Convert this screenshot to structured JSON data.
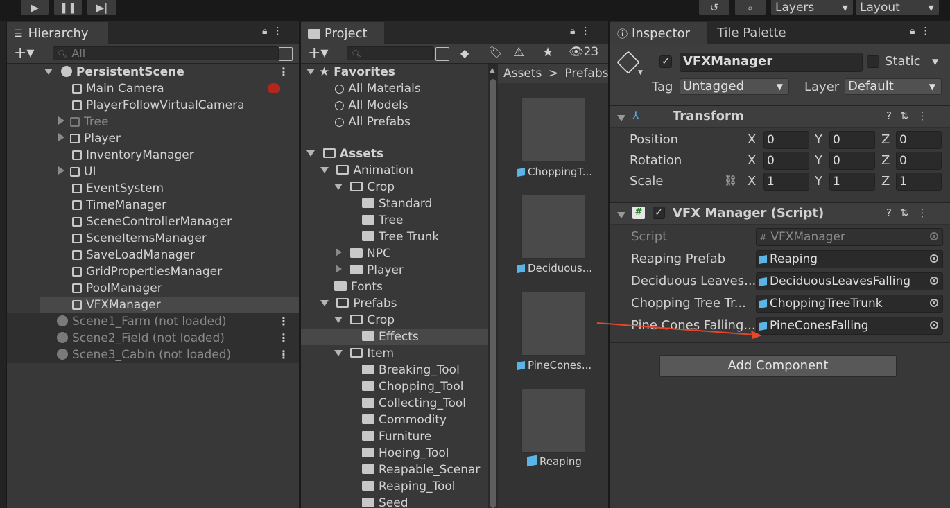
{
  "toolbar": {
    "layers": "Layers",
    "layout": "Layout"
  },
  "hierarchy": {
    "tab": "Hierarchy",
    "search_placeholder": "All",
    "scene": "PersistentScene",
    "items": [
      "Main Camera",
      "PlayerFollowVirtualCamera",
      "Tree",
      "Player",
      "InventoryManager",
      "UI",
      "EventSystem",
      "TimeManager",
      "SceneControllerManager",
      "SceneItemsManager",
      "SaveLoadManager",
      "GridPropertiesManager",
      "PoolManager",
      "VFXManager"
    ],
    "unloaded": [
      "Scene1_Farm (not loaded)",
      "Scene2_Field (not loaded)",
      "Scene3_Cabin (not loaded)"
    ]
  },
  "project": {
    "tab": "Project",
    "count": "23",
    "favorites": "Favorites",
    "fav_items": [
      "All Materials",
      "All Models",
      "All Prefabs"
    ],
    "assets": "Assets",
    "tree": [
      "Animation",
      "Crop",
      "Standard",
      "Tree",
      "Tree Trunk",
      "NPC",
      "Player",
      "Fonts",
      "Prefabs",
      "Crop",
      "Effects",
      "Item",
      "Breaking_Tool",
      "Chopping_Tool",
      "Collecting_Tool",
      "Commodity",
      "Furniture",
      "Hoeing_Tool",
      "Reapable_Scenar",
      "Reaping_Tool",
      "Seed"
    ],
    "breadcrumb": [
      "Assets",
      ">",
      "Prefabs"
    ],
    "thumbs": [
      "ChoppingT...",
      "Deciduous...",
      "PineCones...",
      "Reaping"
    ]
  },
  "inspector": {
    "tab": "Inspector",
    "tab2": "Tile Palette",
    "object_name": "VFXManager",
    "static": "Static",
    "tag_label": "Tag",
    "tag": "Untagged",
    "layer_label": "Layer",
    "layer": "Default",
    "transform": {
      "title": "Transform",
      "rows": [
        {
          "label": "Position",
          "x": "0",
          "y": "0",
          "z": "0"
        },
        {
          "label": "Rotation",
          "x": "0",
          "y": "0",
          "z": "0"
        },
        {
          "label": "Scale",
          "x": "1",
          "y": "1",
          "z": "1"
        }
      ],
      "axes": [
        "X",
        "Y",
        "Z"
      ]
    },
    "script": {
      "title": "VFX Manager (Script)",
      "fields": [
        {
          "label": "Script",
          "value": "VFXManager"
        },
        {
          "label": "Reaping Prefab",
          "value": "Reaping"
        },
        {
          "label": "Deciduous Leaves...",
          "value": "DeciduousLeavesFalling"
        },
        {
          "label": "Chopping Tree Tr...",
          "value": "ChoppingTreeTrunk"
        },
        {
          "label": "Pine Cones Falling...",
          "value": "PineConesFalling"
        }
      ]
    },
    "add_component": "Add Component"
  },
  "colors": {
    "arrow": "#e8452c",
    "prefab_blue": "#5ab4e6",
    "transform_icon": "#4fb3e8"
  }
}
